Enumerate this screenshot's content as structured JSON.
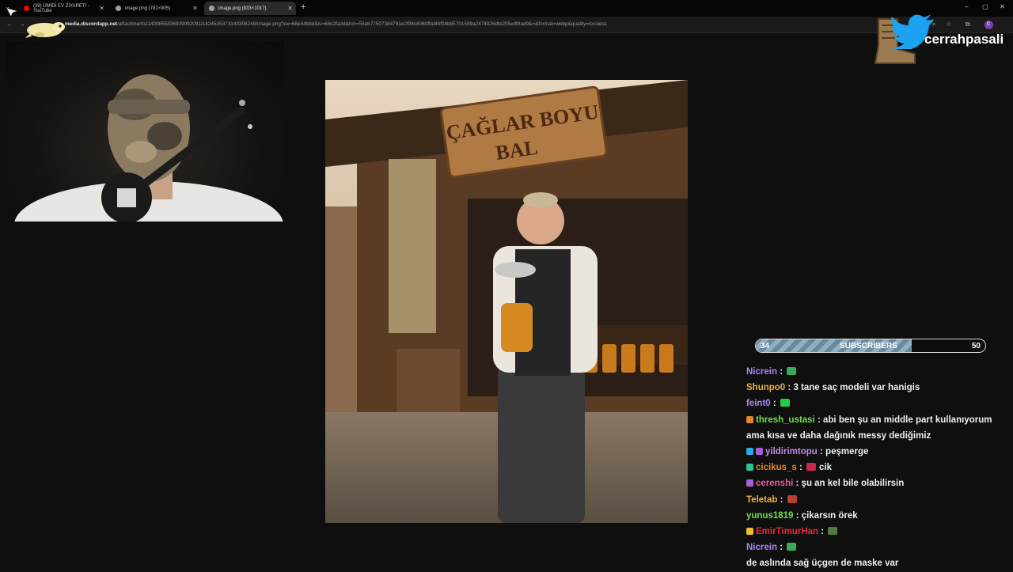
{
  "browser": {
    "tabs": [
      {
        "title": "(39) ÜMİDİ EV ZİYARETİ - YouTube",
        "favicon_color": "#ff0000"
      },
      {
        "title": "image.png (781×905)",
        "favicon_color": "#9aa0a6"
      },
      {
        "title": "image.png (833×1017)",
        "favicon_color": "#9aa0a6",
        "active": true
      }
    ],
    "new_tab_glyph": "+",
    "window_controls": [
      "–",
      "▢",
      "✕"
    ],
    "url_host": "media.discordapp.net",
    "url_rest": "/attachments/1409855836939092091/1424535373143308248/image.png?ex=68e44bbd&is=68e2fa3d&hm=58eb77507384791e2f98c8060f0d44f04b85701599a2474926dfe205e8f8ad9&=&format=webp&quality=lossless",
    "toolbar_icons": [
      "search-icon",
      "star-icon",
      "extensions-icon"
    ],
    "profile_letter": "c"
  },
  "overlay": {
    "channel_name": "cerrahpasali"
  },
  "image_content": {
    "sign_line1": "ÇAĞLAR BOYU",
    "sign_line2": "BAL"
  },
  "subscribers": {
    "current": "34",
    "label": "SUBSCRIBERS",
    "goal": "50",
    "progress": 0.68
  },
  "chat": [
    {
      "user": "Nicrein",
      "color": "#b084f5",
      "text": "",
      "badges": [],
      "emote": "#3aa85a"
    },
    {
      "user": "Shunpo0",
      "color": "#e8b34a",
      "text": "3 tane saç modeli var hanigis",
      "badges": []
    },
    {
      "user": "feint0",
      "color": "#b084f5",
      "text": "",
      "badges": [],
      "emote": "#22cc44"
    },
    {
      "user": "thresh_ustasi",
      "color": "#6ee04a",
      "text": "abi ben şu an middle part kullanıyorum ama kısa ve daha dağınık messy dediğimiz",
      "badges": [
        "#e8852a"
      ]
    },
    {
      "user": "yildirimtopu",
      "color": "#c58ae8",
      "text": "peşmerge",
      "badges": [
        "#2aa8e8",
        "#a560d8"
      ]
    },
    {
      "user": "cicikus_s",
      "color": "#e8852a",
      "text": "cik",
      "badges": [
        "#2ac88a"
      ],
      "emote": "#c8284a"
    },
    {
      "user": "cerenshi",
      "color": "#e85aa0",
      "text": "şu an kel bile olabilirsin",
      "badges": [
        "#a560d8"
      ]
    },
    {
      "user": "Teletab",
      "color": "#e8b34a",
      "text": "",
      "badges": [],
      "emote": "#b84030"
    },
    {
      "user": "yunus1819",
      "color": "#6ee04a",
      "text": "çikarsın örek",
      "badges": []
    },
    {
      "user": "EmirTimurHan",
      "color": "#e8283a",
      "text": "",
      "badges": [
        "#e8c02a"
      ],
      "emote": "#557744"
    },
    {
      "user": "Nicrein",
      "color": "#b084f5",
      "text": "",
      "badges": [],
      "emote": "#3aa85a"
    },
    {
      "user": "",
      "color": "#ffffff",
      "text": "de aslında sağ üçgen de maske var",
      "badges": []
    }
  ]
}
